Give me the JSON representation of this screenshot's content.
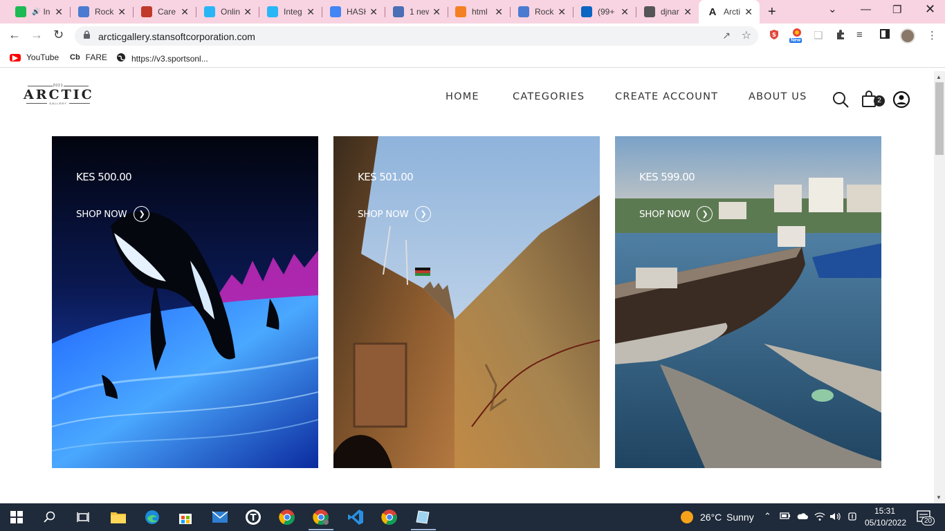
{
  "browser": {
    "tabs": [
      {
        "title": "In",
        "icon": "spotify-icon",
        "color": "#1db954",
        "audio": true
      },
      {
        "title": "Rock",
        "icon": "rocket-icon",
        "color": "#4a7bd0"
      },
      {
        "title": "Care",
        "icon": "careers-icon",
        "color": "#c0392b"
      },
      {
        "title": "Onlin",
        "icon": "flutter-icon",
        "color": "#29b6f6"
      },
      {
        "title": "Integ",
        "icon": "flutter-icon",
        "color": "#29b6f6"
      },
      {
        "title": "HASH",
        "icon": "docs-icon",
        "color": "#4285f4"
      },
      {
        "title": "1 new",
        "icon": "globe-icon",
        "color": "#4a6fb5"
      },
      {
        "title": "html",
        "icon": "stackoverflow-icon",
        "color": "#f48024"
      },
      {
        "title": "Rock",
        "icon": "rocket-icon",
        "color": "#4a7bd0"
      },
      {
        "title": "(99+",
        "icon": "linkedin-icon",
        "color": "#0a66c2"
      },
      {
        "title": "djnar",
        "icon": "globe-icon",
        "color": "#555555"
      },
      {
        "title": "Arcti",
        "icon": "arctic-icon",
        "color": "#222222",
        "active": true
      }
    ],
    "url": "arcticgallery.stansoftcorporation.com",
    "extension_badge": "New",
    "bookmarks": [
      {
        "label": "YouTube",
        "icon": "youtube-icon"
      },
      {
        "label": "FARE",
        "icon": "cb-icon",
        "icon_text": "Cb"
      },
      {
        "label": "https://v3.sportsonl...",
        "icon": "globe-icon"
      }
    ]
  },
  "site": {
    "logo": {
      "small_top": "2021",
      "main": "ARCTIC",
      "small_bottom": "GALLERY"
    },
    "nav": [
      "HOME",
      "CATEGORIES",
      "CREATE ACCOUNT",
      "ABOUT US"
    ],
    "cart_count": "2",
    "products": [
      {
        "price": "KES 500.00",
        "cta": "SHOP NOW",
        "image": "orca-artwork"
      },
      {
        "price": "KES 501.00",
        "cta": "SHOP NOW",
        "image": "fort-jesus-walls"
      },
      {
        "price": "KES 599.00",
        "cta": "SHOP NOW",
        "image": "harbour-boats"
      }
    ]
  },
  "taskbar": {
    "weather": {
      "temp": "26°C",
      "condition": "Sunny"
    },
    "time": "15:31",
    "date": "05/10/2022",
    "notifications": "20"
  },
  "colors": {
    "tabstrip": "#f8d3e1",
    "taskbar": "#1f2a3a",
    "accent": "#1a73e8"
  }
}
